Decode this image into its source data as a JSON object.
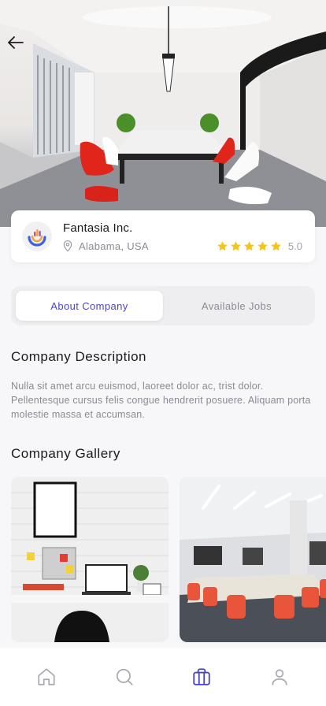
{
  "hero": {
    "back_icon": "arrow-left-icon"
  },
  "company": {
    "name": "Fantasia Inc.",
    "location": "Alabama, USA",
    "rating": 5,
    "rating_label": "5.0",
    "star_color": "#f5c518",
    "logo_icon": "company-logo-icon"
  },
  "tabs": [
    {
      "label": "About Company",
      "active": true
    },
    {
      "label": "Available Jobs",
      "active": false
    }
  ],
  "accent_color": "#4b45c4",
  "description": {
    "title": "Company Description",
    "text": "Nulla sit amet arcu euismod, laoreet dolor ac, trist dolor. Pellentesque cursus felis congue hendrerit posuere. Aliquam porta molestie massa et accumsan."
  },
  "gallery": {
    "title": "Company Gallery",
    "photos": [
      "office-desk-photo",
      "meeting-room-photo"
    ]
  },
  "bottom_nav": [
    {
      "icon": "home-icon",
      "active": false
    },
    {
      "icon": "search-icon",
      "active": false
    },
    {
      "icon": "briefcase-icon",
      "active": true
    },
    {
      "icon": "profile-icon",
      "active": false
    }
  ]
}
